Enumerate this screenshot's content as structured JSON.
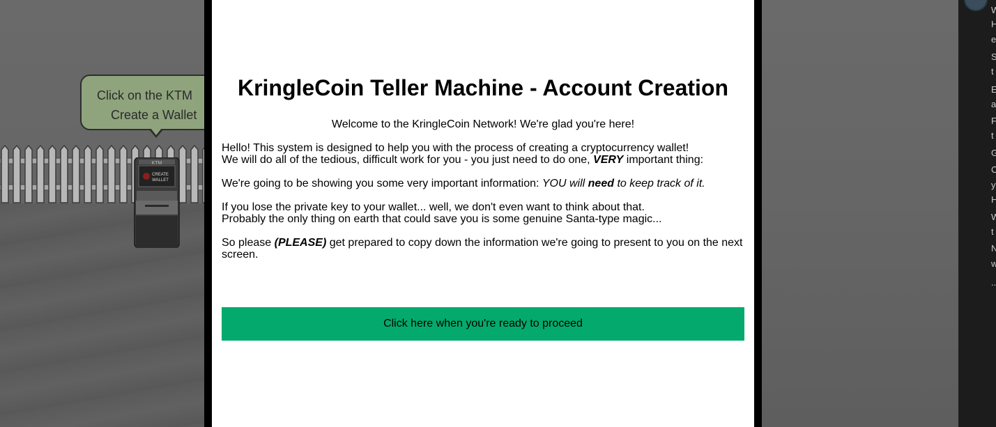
{
  "game": {
    "bubble": {
      "line1": "Click on the KTM",
      "line2": "Create a Wallet"
    },
    "ktm": {
      "label": "KTM",
      "screen_line1": "CREATE",
      "screen_line2": "WALLET"
    }
  },
  "right_panel": {
    "letters": [
      "W",
      "H",
      "e",
      "S",
      "t",
      "E",
      "a",
      "F",
      "t",
      "G",
      "C",
      "y",
      "H",
      "W",
      "t",
      "N",
      "w",
      "..."
    ]
  },
  "modal": {
    "title": "KringleCoin Teller Machine - Account Creation",
    "welcome": "Welcome to the KringleCoin Network! We're glad you're here!",
    "p1": {
      "line1": "Hello! This system is designed to help you with the process of creating a cryptocurrency wallet!",
      "line2_a": "We will do all of the tedious, difficult work for you - you just need to do one, ",
      "line2_emph": "VERY",
      "line2_b": " important thing:"
    },
    "p2": {
      "a": "We're going to be showing you some very important information: ",
      "em_a": "YOU will ",
      "em_strong": "need",
      "em_b": " to keep track of it."
    },
    "p3": {
      "line1": "If you lose the private key to your wallet... well, we don't even want to think about that.",
      "line2": "Probably the only thing on earth that could save you is some genuine Santa-type magic..."
    },
    "p4": {
      "a": "So please ",
      "emph": "(PLEASE)",
      "b": " get prepared to copy down the information we're going to present to you on the next screen."
    },
    "button_label": "Click here when you're ready to proceed"
  },
  "colors": {
    "button": "#04aa6d",
    "bubble": "#8fa47d",
    "backdrop": "#5c5c5c"
  }
}
